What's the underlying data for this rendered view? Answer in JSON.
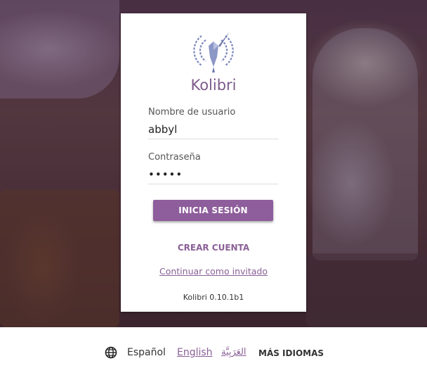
{
  "app": {
    "title": "Kolibri",
    "version": "Kolibri 0.10.1b1"
  },
  "login": {
    "username_label": "Nombre de usuario",
    "username_value": "abbyl",
    "password_label": "Contraseña",
    "password_value": "•••••",
    "submit_label": "INICIA SESIÓN",
    "create_account_label": "CREAR CUENTA",
    "guest_link_label": "Continuar como invitado"
  },
  "language_bar": {
    "current": "Español",
    "options": [
      "English",
      "العَرَبِيَّة"
    ],
    "more_label": "MÁS IDIOMAS",
    "icon": "globe-icon"
  },
  "colors": {
    "accent": "#8e5d9b",
    "link": "#8a5f96"
  }
}
